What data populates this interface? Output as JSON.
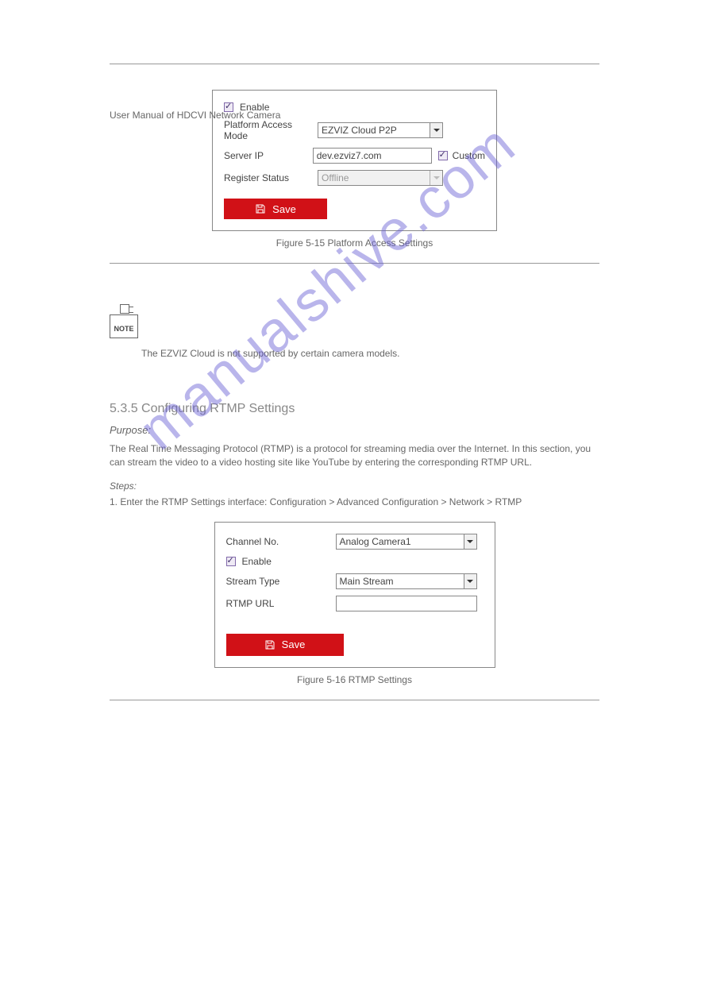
{
  "header": {
    "title": "User Manual of HDCVI Network Camera"
  },
  "dialog1": {
    "enable_label": "Enable",
    "platform_label": "Platform Access Mode",
    "platform_value": "EZVIZ Cloud P2P",
    "serverip_label": "Server IP",
    "serverip_value": "dev.ezviz7.com",
    "custom_label": "Custom",
    "register_label": "Register Status",
    "register_value": "Offline",
    "save_label": "Save"
  },
  "caption1": "Figure 5-15 Platform Access Settings",
  "note_text": "NOTE",
  "note_para": "The EZVIZ Cloud is not supported by certain camera models.",
  "section_heading": "5.3.5 Configuring RTMP Settings",
  "purpose": "Purpose:",
  "rtmp_para": "The Real Time Messaging Protocol (RTMP) is a protocol for streaming media over the Internet. In this section, you can stream the video to a video hosting site like YouTube by entering the corresponding RTMP URL.",
  "steps": {
    "s1_label": "Steps:",
    "s1": "1. Enter the RTMP Settings interface: Configuration > Advanced Configuration > Network > RTMP"
  },
  "dialog2": {
    "channel_label": "Channel No.",
    "channel_value": "Analog Camera1",
    "enable_label": "Enable",
    "stream_label": "Stream Type",
    "stream_value": "Main Stream",
    "rtmp_label": "RTMP URL",
    "rtmp_value": "",
    "save_label": "Save"
  },
  "caption2": "Figure 5-16 RTMP Settings",
  "watermark": "manualshive.com"
}
